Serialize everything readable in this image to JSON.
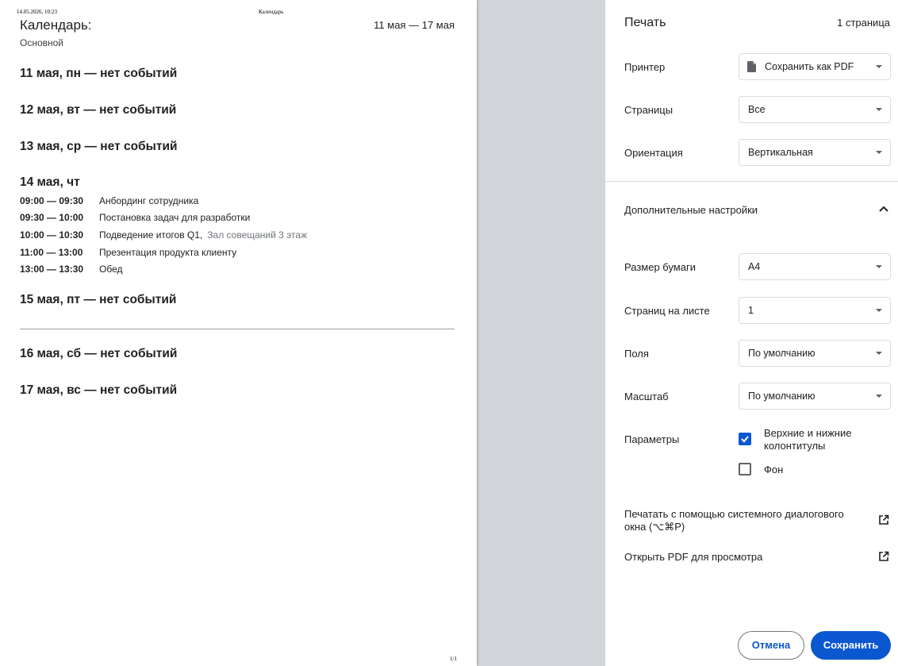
{
  "preview": {
    "header_date": "14.05.2026, 10:23",
    "header_title": "Календарь",
    "title": "Календарь:",
    "range": "11 мая — 17 мая",
    "subtitle": "Основной",
    "days": [
      {
        "heading": "11 мая, пн — нет событий"
      },
      {
        "heading": "12 мая, вт — нет событий"
      },
      {
        "heading": "13 мая, ср — нет событий"
      },
      {
        "heading": "14 мая, чт",
        "events": [
          {
            "time": "09:00 — 09:30",
            "title": "Анбординг сотрудника"
          },
          {
            "time": "09:30 — 10:00",
            "title": "Постановка задач для разработки"
          },
          {
            "time": "10:00 — 10:30",
            "title": "Подведение итогов Q1,",
            "location": "Зал совещаний 3 этаж"
          },
          {
            "time": "11:00 — 13:00",
            "title": "Презентация продукта клиенту"
          },
          {
            "time": "13:00 — 13:30",
            "title": "Обед"
          }
        ]
      },
      {
        "heading": "15 мая, пт — нет событий"
      },
      {
        "heading": "16 мая, сб — нет событий"
      },
      {
        "heading": "17 мая, вс — нет событий"
      }
    ],
    "page_counter": "1/1"
  },
  "settings": {
    "title": "Печать",
    "sheet_count": "1 страница",
    "printer": {
      "label": "Принтер",
      "value": "Сохранить как PDF",
      "icon": "file-icon"
    },
    "pages": {
      "label": "Страницы",
      "value": "Все"
    },
    "orientation": {
      "label": "Ориентация",
      "value": "Вертикальная"
    },
    "advanced": {
      "label": "Дополнительные настройки",
      "icon": "chevron-up-icon"
    },
    "paper_size": {
      "label": "Размер бумаги",
      "value": "A4"
    },
    "pages_per_sheet": {
      "label": "Страниц на листе",
      "value": "1"
    },
    "margins": {
      "label": "Поля",
      "value": "По умолчанию"
    },
    "scale": {
      "label": "Масштаб",
      "value": "По умолчанию"
    },
    "options": {
      "label": "Параметры",
      "headers_footers": {
        "label": "Верхние и нижние колонтитулы",
        "checked": true
      },
      "background": {
        "label": "Фон",
        "checked": false
      }
    },
    "system_dialog": {
      "label": "Печатать с помощью системного диалогового окна (⌥⌘P)",
      "icon": "open-in-new-icon"
    },
    "open_pdf": {
      "label": "Открыть PDF для просмотра",
      "icon": "open-in-new-icon"
    },
    "buttons": {
      "cancel": "Отмена",
      "save": "Сохранить"
    },
    "colors": {
      "accent": "#0b57d0",
      "border": "#dadce0",
      "backdrop": "#d1d4d9"
    }
  }
}
